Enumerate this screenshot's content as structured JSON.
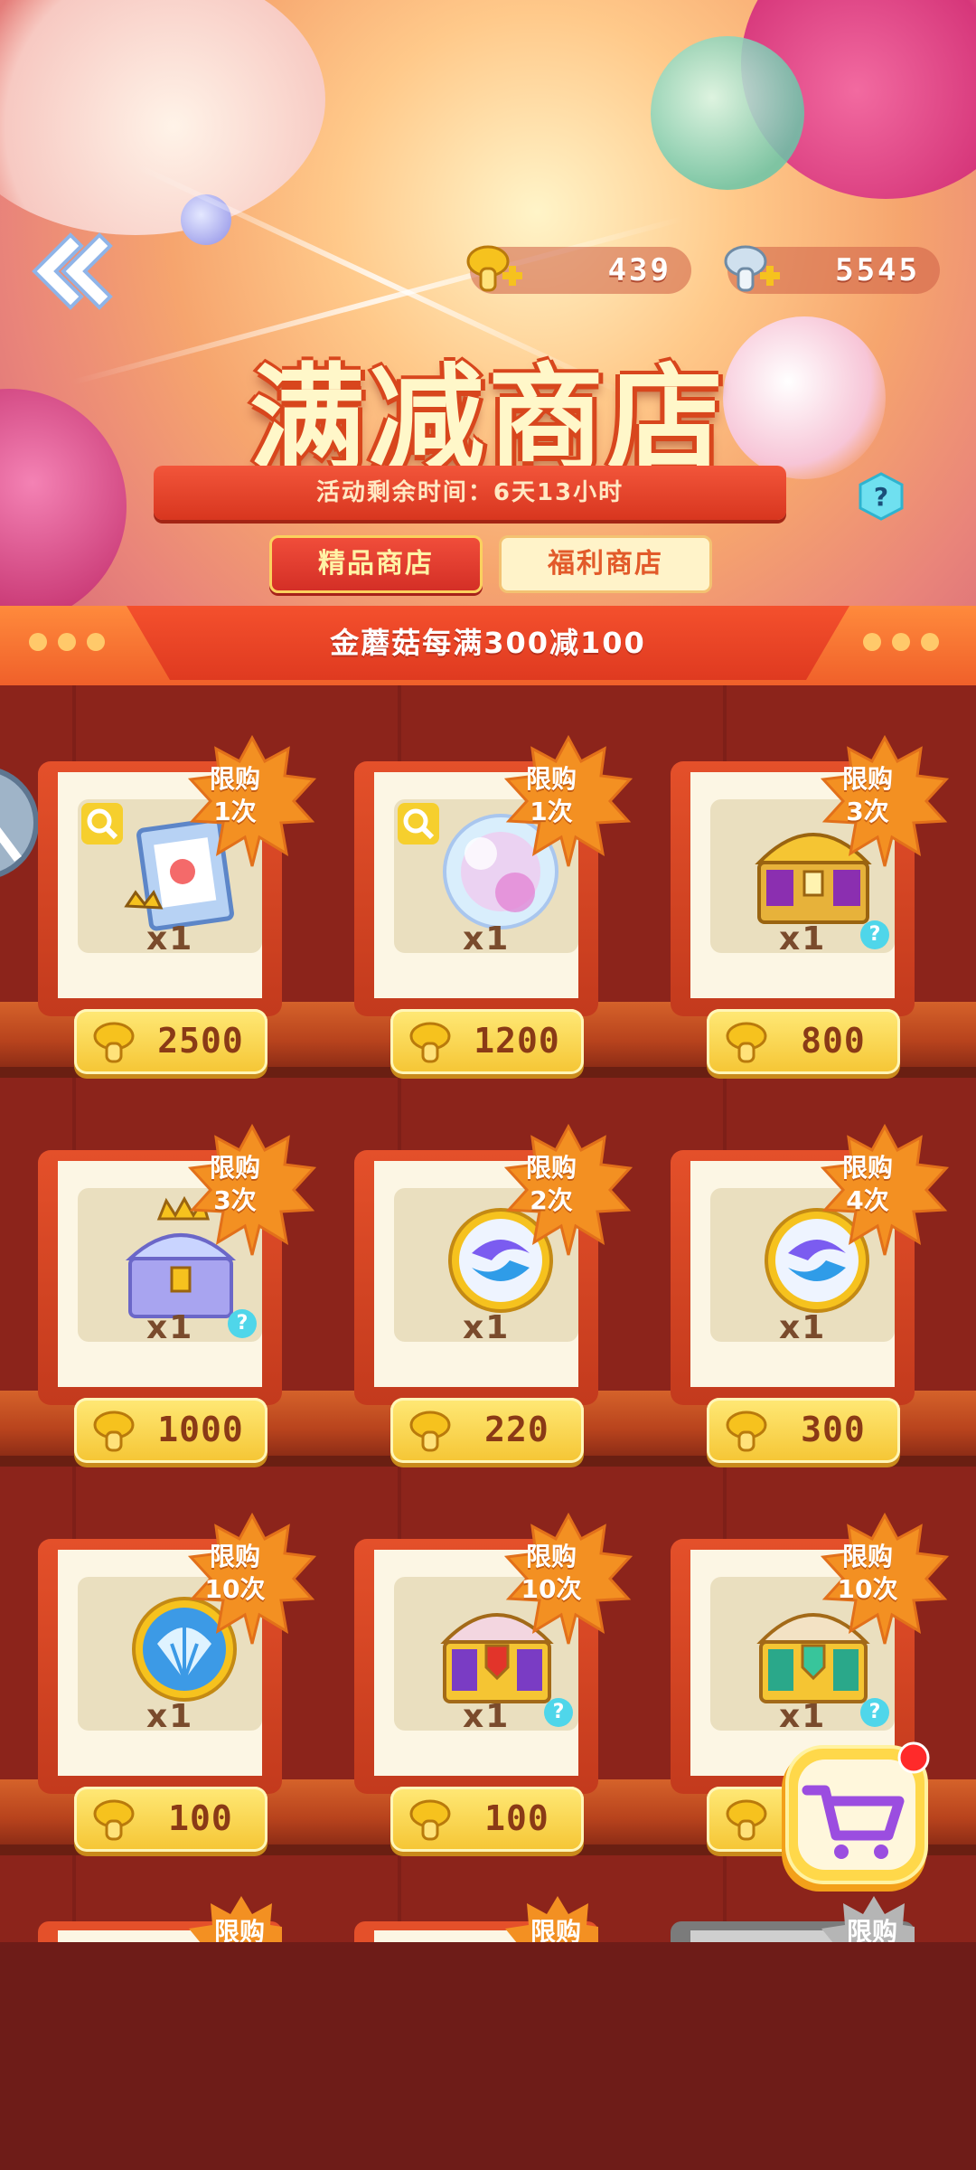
{
  "header": {
    "currencies": [
      {
        "name": "gold-mushroom",
        "amount": "439"
      },
      {
        "name": "silver-mushroom",
        "amount": "5545"
      }
    ],
    "title": "满减商店",
    "event_timer": "活动剩余时间：6天13小时",
    "tabs": [
      {
        "label": "精品商店",
        "active": true
      },
      {
        "label": "福利商店",
        "active": false
      }
    ]
  },
  "promo_banner": "金蘑菇每满300减100",
  "shop_items": [
    {
      "limit": "限购\n1次",
      "qty": "x1",
      "price": "2500",
      "item": "photo-frame",
      "has_zoom": true,
      "has_info": false
    },
    {
      "limit": "限购\n1次",
      "qty": "x1",
      "price": "1200",
      "item": "crystal-ball",
      "has_zoom": true,
      "has_info": false
    },
    {
      "limit": "限购\n3次",
      "qty": "x1",
      "price": "800",
      "item": "gold-chest",
      "has_zoom": false,
      "has_info": true
    },
    {
      "limit": "限购\n3次",
      "qty": "x1",
      "price": "1000",
      "item": "crown-chest",
      "has_zoom": false,
      "has_info": true
    },
    {
      "limit": "限购\n2次",
      "qty": "x1",
      "price": "220",
      "item": "swirl-orb",
      "has_zoom": false,
      "has_info": false
    },
    {
      "limit": "限购\n4次",
      "qty": "x1",
      "price": "300",
      "item": "swirl-orb",
      "has_zoom": false,
      "has_info": false
    },
    {
      "limit": "限购\n10次",
      "qty": "x1",
      "price": "100",
      "item": "shell-orb",
      "has_zoom": false,
      "has_info": false
    },
    {
      "limit": "限购\n10次",
      "qty": "x1",
      "price": "100",
      "item": "red-chest",
      "has_zoom": false,
      "has_info": true
    },
    {
      "limit": "限购\n10次",
      "qty": "x1",
      "price": "",
      "item": "green-chest",
      "has_zoom": false,
      "has_info": true
    }
  ],
  "partial_tags": [
    "限购",
    "限购",
    "限购"
  ],
  "colors": {
    "accent_red": "#d8361f",
    "gold": "#f5c533",
    "cart_purple": "#9b4de0",
    "badge_red": "#ff2a2a"
  }
}
